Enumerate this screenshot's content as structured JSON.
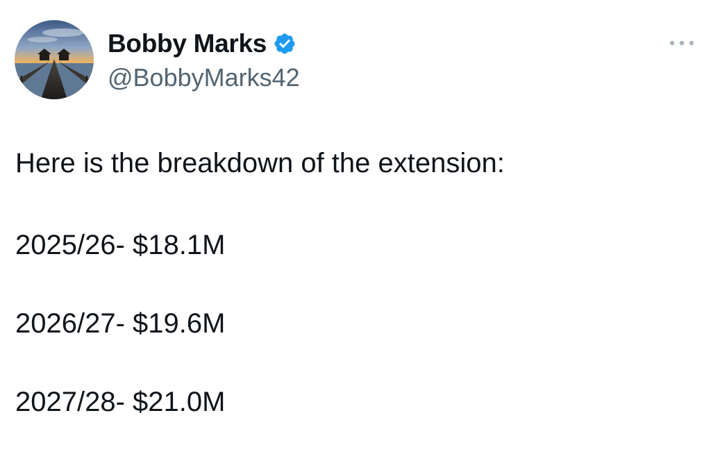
{
  "author": {
    "display_name": "Bobby Marks",
    "handle": "@BobbyMarks42",
    "verified": true,
    "avatar_icon": "pier-sunset-avatar",
    "verified_color": "#1d9bf0"
  },
  "menu": {
    "icon": "more-options-icon"
  },
  "tweet": {
    "lines": [
      "Here is the breakdown of the extension:",
      "2025/26- $18.1M",
      "2026/27- $19.6M",
      "2027/28- $21.0M"
    ]
  },
  "colors": {
    "text": "#0f1419",
    "secondary": "#536471",
    "background": "#ffffff"
  }
}
